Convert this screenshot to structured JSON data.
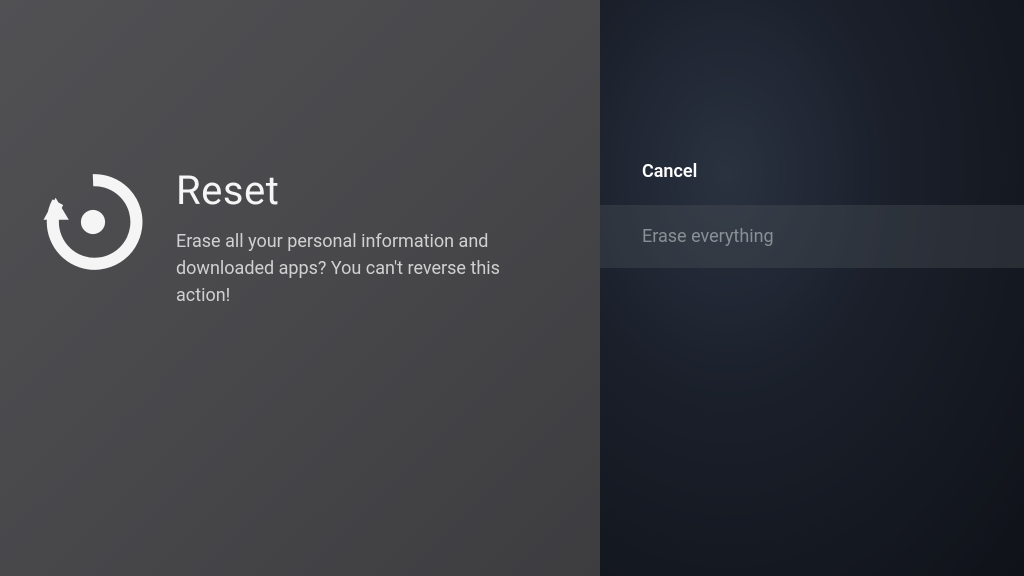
{
  "reset": {
    "title": "Reset",
    "description": "Erase all your personal information and downloaded apps? You can't reverse this action!"
  },
  "options": {
    "cancel": "Cancel",
    "erase": "Erase everything"
  }
}
